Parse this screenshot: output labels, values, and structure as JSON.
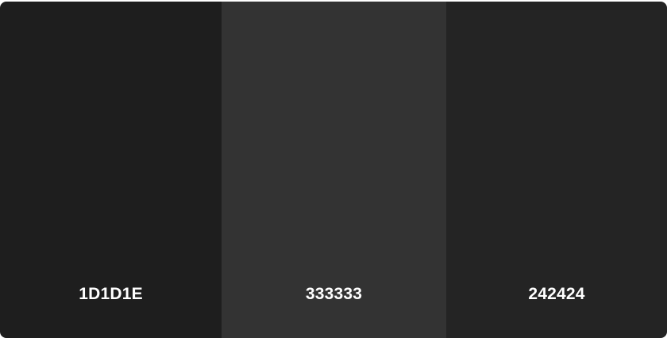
{
  "palette": {
    "swatches": [
      {
        "hex_label": "1D1D1E",
        "color": "#1e1e1e"
      },
      {
        "hex_label": "333333",
        "color": "#333333"
      },
      {
        "hex_label": "242424",
        "color": "#242424"
      }
    ]
  }
}
